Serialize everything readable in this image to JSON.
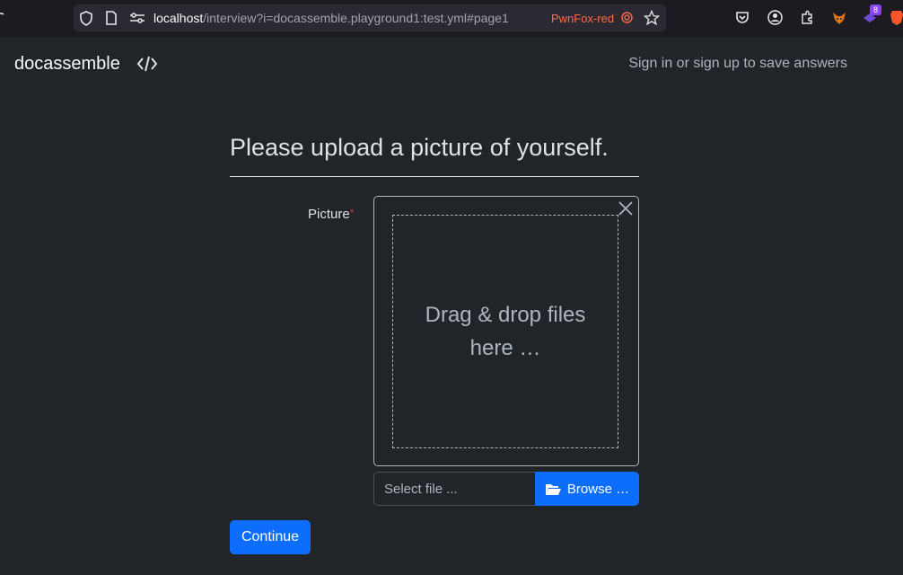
{
  "browser": {
    "url_host": "localhost",
    "url_path": "/interview?i=docassemble.playground1:test.yml#page1",
    "container_label": "PwnFox-red",
    "extension_badge": "8",
    "icons": [
      "shield-icon",
      "page-icon",
      "permissions-icon",
      "star-icon",
      "pocket-icon",
      "account-icon",
      "extensions-icon",
      "fox-extension-icon",
      "badge-extension-icon",
      "brave-extension-icon"
    ]
  },
  "navbar": {
    "brand": "docassemble",
    "signin": "Sign in or sign up to save answers"
  },
  "question": {
    "title": "Please upload a picture of yourself."
  },
  "field": {
    "label": "Picture",
    "required_mark": "*",
    "drop_text": "Drag & drop files here …",
    "file_placeholder": "Select file ...",
    "browse_label": "Browse …"
  },
  "actions": {
    "continue_label": "Continue"
  },
  "colors": {
    "background": "#212529",
    "primary": "#0d6efd",
    "container_red": "#ff6a4d"
  }
}
